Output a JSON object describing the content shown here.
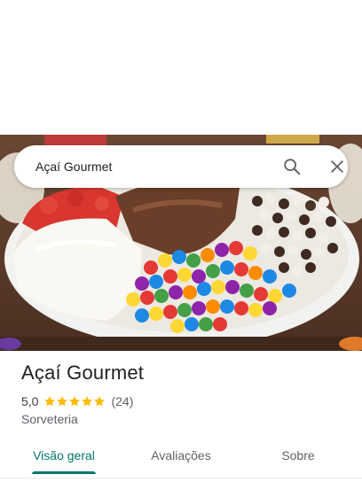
{
  "search": {
    "query": "Açaí Gourmet"
  },
  "place": {
    "name": "Açaí Gourmet",
    "rating": "5,0",
    "stars": 5,
    "reviews": "(24)",
    "category": "Sorveteria"
  },
  "tabs": [
    {
      "label": "Visão geral",
      "active": true
    },
    {
      "label": "Avaliações",
      "active": false
    },
    {
      "label": "Sobre",
      "active": false
    }
  ],
  "colors": {
    "accent": "#00796b",
    "star": "#fbbc04"
  },
  "icons": {
    "search": "search-icon",
    "close": "close-icon",
    "star": "star-icon"
  }
}
